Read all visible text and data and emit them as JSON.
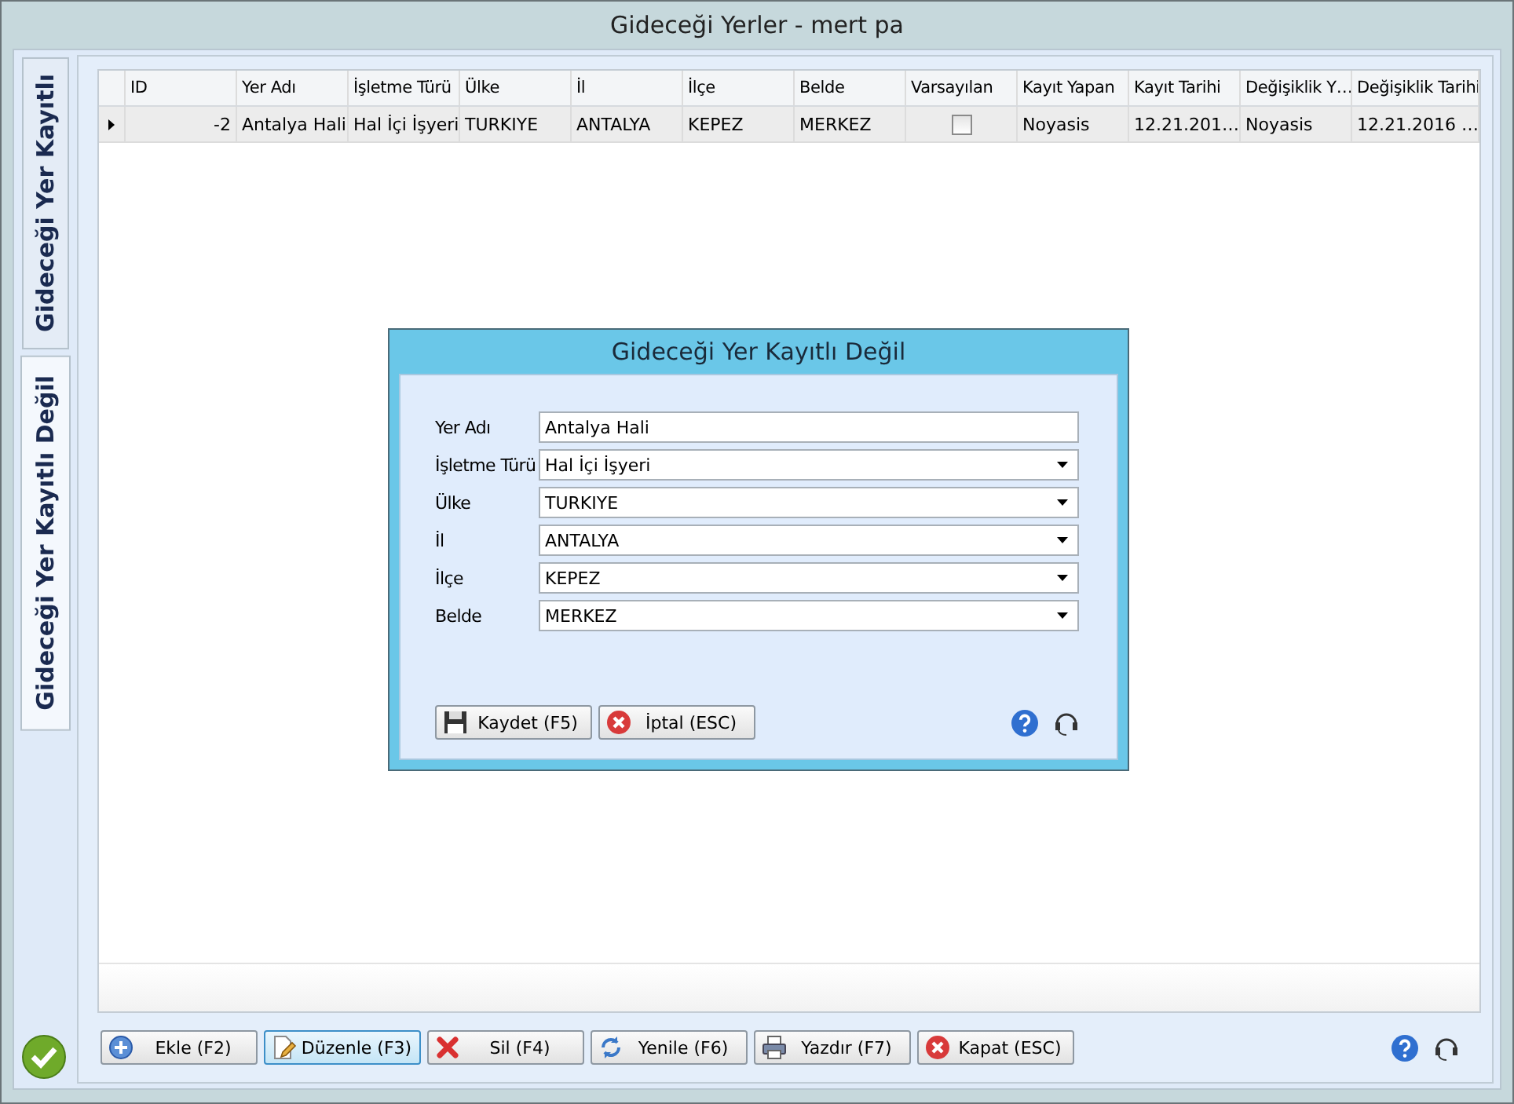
{
  "window": {
    "title": "Gideceği Yerler - mert pa"
  },
  "tabs": [
    {
      "label": "Gideceği Yer Kayıtlı",
      "selected": false
    },
    {
      "label": "Gideceği Yer Kayıtlı Değil",
      "selected": true
    }
  ],
  "table": {
    "columns": [
      "ID",
      "Yer Adı",
      "İşletme Türü",
      "Ülke",
      "İl",
      "İlçe",
      "Belde",
      "Varsayılan",
      "Kayıt Yapan",
      "Kayıt Tarihi",
      "Değişiklik Y…",
      "Değişiklik Tarihi"
    ],
    "rows": [
      {
        "selected": true,
        "cells": [
          {
            "kind": "number",
            "text": "-2"
          },
          {
            "kind": "text",
            "text": "Antalya Hali"
          },
          {
            "kind": "text",
            "text": "Hal İçi İşyeri"
          },
          {
            "kind": "text",
            "text": "TURKIYE"
          },
          {
            "kind": "text",
            "text": "ANTALYA"
          },
          {
            "kind": "text",
            "text": "KEPEZ"
          },
          {
            "kind": "text",
            "text": "MERKEZ"
          },
          {
            "kind": "checkbox",
            "checked": false
          },
          {
            "kind": "text",
            "text": "Noyasis"
          },
          {
            "kind": "text",
            "text": "12.21.201…"
          },
          {
            "kind": "text",
            "text": "Noyasis"
          },
          {
            "kind": "text",
            "text": "12.21.2016 …"
          }
        ]
      }
    ]
  },
  "dialog": {
    "title": "Gideceği Yer Kayıtlı Değil",
    "fields": [
      {
        "label": "Yer Adı",
        "kind": "text",
        "value": "Antalya Hali"
      },
      {
        "label": "İşletme Türü",
        "kind": "combo",
        "value": "Hal İçi İşyeri"
      },
      {
        "label": "Ülke",
        "kind": "combo",
        "value": "TURKIYE"
      },
      {
        "label": "İl",
        "kind": "combo",
        "value": "ANTALYA"
      },
      {
        "label": "İlçe",
        "kind": "combo",
        "value": "KEPEZ"
      },
      {
        "label": "Belde",
        "kind": "combo",
        "value": "MERKEZ"
      }
    ],
    "buttons": [
      {
        "label": "Kaydet (F5)",
        "kind": "save"
      },
      {
        "label": "İptal (ESC)",
        "kind": "cancel"
      }
    ]
  },
  "buttons": [
    {
      "label": "Ekle (F2)",
      "kind": "add",
      "focused": false
    },
    {
      "label": "Düzenle (F3)",
      "kind": "edit",
      "focused": true
    },
    {
      "label": "Sil (F4)",
      "kind": "delete",
      "focused": false
    },
    {
      "label": "Yenile (F6)",
      "kind": "refresh",
      "focused": false
    },
    {
      "label": "Yazdır (F7)",
      "kind": "print",
      "focused": false
    },
    {
      "label": "Kapat (ESC)",
      "kind": "cancel",
      "focused": false
    }
  ]
}
